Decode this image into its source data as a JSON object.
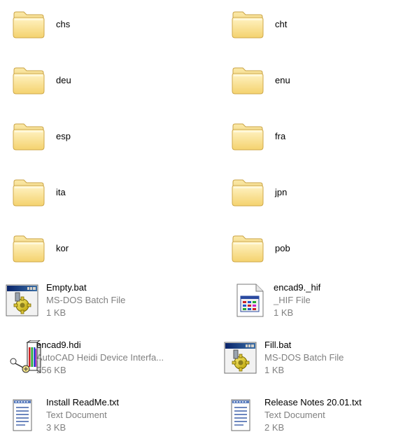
{
  "folders": [
    {
      "name": "chs",
      "icon": "folder-icon"
    },
    {
      "name": "cht",
      "icon": "folder-icon"
    },
    {
      "name": "deu",
      "icon": "folder-icon"
    },
    {
      "name": "enu",
      "icon": "folder-icon"
    },
    {
      "name": "esp",
      "icon": "folder-icon"
    },
    {
      "name": "fra",
      "icon": "folder-icon"
    },
    {
      "name": "ita",
      "icon": "folder-icon"
    },
    {
      "name": "jpn",
      "icon": "folder-icon"
    },
    {
      "name": "kor",
      "icon": "folder-icon"
    },
    {
      "name": "pob",
      "icon": "folder-icon"
    }
  ],
  "files": [
    {
      "name": "Empty.bat",
      "type": "MS-DOS Batch File",
      "size": "1 KB",
      "icon": "batch-file-icon"
    },
    {
      "name": "encad9._hif",
      "type": "_HIF File",
      "size": "1 KB",
      "icon": "hif-file-icon"
    },
    {
      "name": "encad9.hdi",
      "type": "AutoCAD Heidi Device Interfa...",
      "size": "256 KB",
      "icon": "heidi-driver-icon"
    },
    {
      "name": "Fill.bat",
      "type": "MS-DOS Batch File",
      "size": "1 KB",
      "icon": "batch-file-icon"
    },
    {
      "name": "Install ReadMe.txt",
      "type": "Text Document",
      "size": "3 KB",
      "icon": "text-document-icon"
    },
    {
      "name": "Release Notes 20.01.txt",
      "type": "Text Document",
      "size": "2 KB",
      "icon": "text-document-icon"
    }
  ],
  "colors": {
    "secondary_text": "#808080",
    "folder_fill": "#f6d97a",
    "window_title": "#0a246a"
  }
}
